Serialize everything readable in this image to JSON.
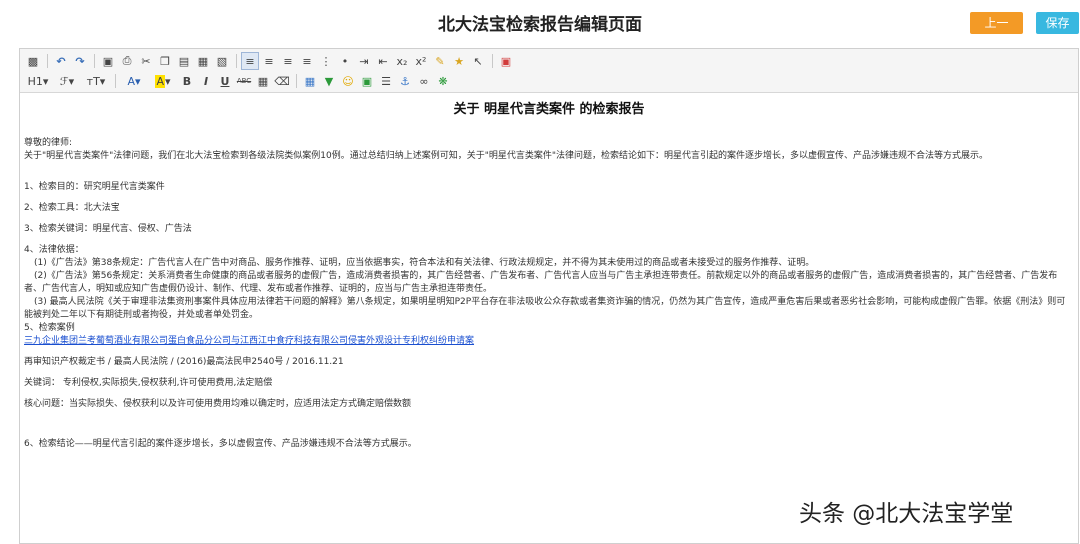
{
  "header": {
    "title": "北大法宝检索报告编辑页面",
    "prev_label": "上一步",
    "save_label": "保存"
  },
  "toolbar": {
    "row1": [
      "source-icon",
      "undo-icon",
      "redo-icon",
      "preview-icon",
      "print-icon",
      "cut-icon",
      "copy-icon",
      "paste-icon",
      "paste-text-icon",
      "paste-word-icon",
      "align-left-icon",
      "align-center-icon",
      "align-right-icon",
      "align-justify-icon",
      "ordered-list-icon",
      "unordered-list-icon",
      "indent-icon",
      "outdent-icon",
      "subscript-icon",
      "superscript-icon",
      "format-painter-icon",
      "clear-format-icon",
      "select-icon",
      "fullscreen-icon"
    ],
    "heading_label": "H1",
    "font_family_label": "ℱ",
    "font_size_label": "тT",
    "font_color_label": "A",
    "highlight_label": "A",
    "bold_label": "B",
    "italic_label": "I",
    "underline_label": "U",
    "strike_label": "ABC"
  },
  "document": {
    "title": "关于 明星代言类案件 的检索报告",
    "salutation": "尊敬的律师:",
    "intro": "关于\"明星代言类案件\"法律问题，我们在北大法宝检索到各级法院类似案例10例。通过总结归纳上述案例可知，关于\"明星代言类案件\"法律问题，检索结论如下：明星代言引起的案件逐步增长，多以虚假宣传、产品涉嫌违规不合法等方式展示。",
    "item1": "1、检索目的：研究明星代言类案件",
    "item2": "2、检索工具：北大法宝",
    "item3": "3、检索关键词：明星代言、侵权、广告法",
    "item4": "4、法律依据：",
    "law1": "(1)《广告法》第38条规定：广告代言人在广告中对商品、服务作推荐、证明，应当依据事实，符合本法和有关法律、行政法规规定，并不得为其未使用过的商品或者未接受过的服务作推荐、证明。",
    "law2": "(2)《广告法》第56条规定：关系消费者生命健康的商品或者服务的虚假广告，造成消费者损害的，其广告经营者、广告发布者、广告代言人应当与广告主承担连带责任。前款规定以外的商品或者服务的虚假广告，造成消费者损害的，其广告经营者、广告发布者、广告代言人，明知或应知广告虚假仍设计、制作、代理、发布或者作推荐、证明的，应当与广告主承担连带责任。",
    "law3": "(3) 最高人民法院《关于审理非法集资刑事案件具体应用法律若干问题的解释》第八条规定，如果明星明知P2P平台存在非法吸收公众存款或者集资诈骗的情况，仍然为其广告宣传，造成严重危害后果或者恶劣社会影响，可能构成虚假广告罪。依据《刑法》则可能被判处二年以下有期徒刑或者拘役，并处或者单处罚金。",
    "item5": "5、检索案例",
    "case_link": "三九企业集团兰考葡萄酒业有限公司蛋白食品分公司与江西江中食疗科技有限公司侵害外观设计专利权纠纷申请案",
    "case_meta": "再审知识产权裁定书 / 最高人民法院  / (2016)最高法民申2540号 / 2016.11.21",
    "case_keywords": "关键词：  专利侵权,实际损失,侵权获利,许可使用费用,法定赔偿",
    "case_core": "核心问题：当实际损失、侵权获利以及许可使用费用均难以确定时，应适用法定方式确定赔偿数额",
    "item6": "6、检索结论——明星代言引起的案件逐步增长，多以虚假宣传、产品涉嫌违规不合法等方式展示。"
  },
  "watermark": "头条 @北大法宝学堂"
}
